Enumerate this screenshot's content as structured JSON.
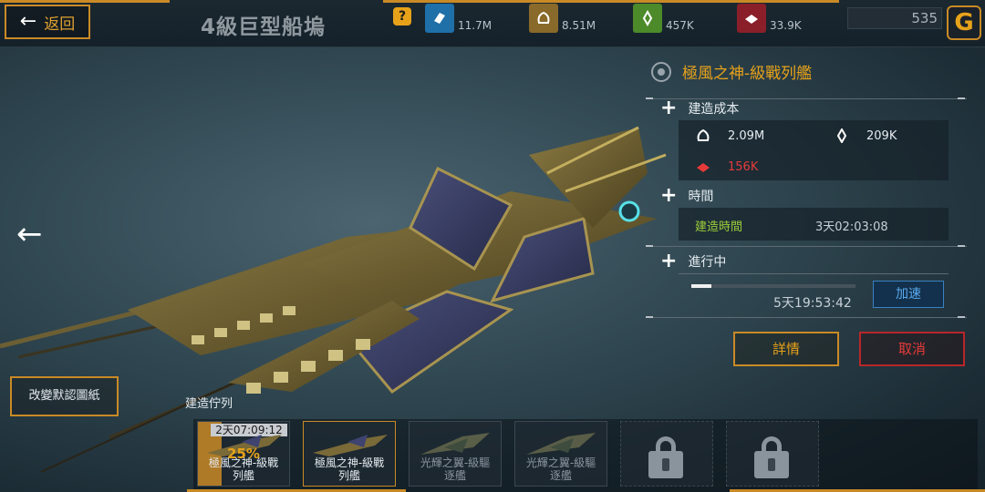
{
  "header": {
    "back_label": "返回",
    "title": "4級巨型船塢",
    "help_icon": "question-icon",
    "resources": [
      {
        "icon": "metal-icon",
        "value": "11.7M",
        "color": "#1f6fa8"
      },
      {
        "icon": "ore-icon",
        "value": "8.51M",
        "color": "#8a6a2a"
      },
      {
        "icon": "crystal-icon",
        "value": "457K",
        "color": "#4c8a2a"
      },
      {
        "icon": "alloy-icon",
        "value": "33.9K",
        "color": "#8a1f2a"
      }
    ],
    "credits": "535",
    "g_logo": "G"
  },
  "panel": {
    "ship_name": "極風之神-級戰列艦",
    "build_cost_title": "建造成本",
    "costs": [
      {
        "icon": "ore-icon",
        "value": "2.09M",
        "color": "#e5ebf0"
      },
      {
        "icon": "crystal-icon",
        "value": "209K",
        "color": "#e5ebf0"
      },
      {
        "icon": "alloy-icon",
        "value": "156K",
        "color": "#e63a3a"
      }
    ],
    "time_title": "時間",
    "build_time_label": "建造時間",
    "build_time_value": "3天02:03:08",
    "in_progress_title": "進行中",
    "progress": 0.12,
    "remaining": "5天19:53:42",
    "speed_up_label": "加速"
  },
  "actions": {
    "details_label": "詳情",
    "cancel_label": "取消",
    "change_blueprint_label": "改變默認圖紙"
  },
  "queue": {
    "title": "建造佇列",
    "slots": [
      {
        "state": "building",
        "timer": "2天07:09:12",
        "percent": "25%",
        "line1": "極風之神-級戰",
        "line2": "列艦"
      },
      {
        "state": "queued",
        "line1": "極風之神-級戰",
        "line2": "列艦"
      },
      {
        "state": "queued",
        "line1": "光輝之翼-級驅",
        "line2": "逐艦"
      },
      {
        "state": "queued",
        "line1": "光輝之翼-級驅",
        "line2": "逐艦"
      },
      {
        "state": "locked"
      },
      {
        "state": "locked"
      }
    ]
  }
}
